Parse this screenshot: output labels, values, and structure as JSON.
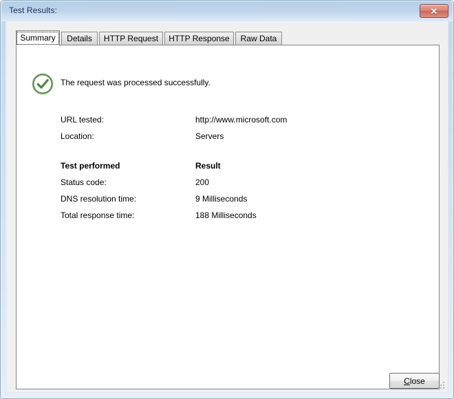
{
  "window": {
    "title": "Test Results:",
    "close_button_glyph": "✕",
    "close_button_name": "Close"
  },
  "tabs": [
    {
      "label": "Summary",
      "active": true
    },
    {
      "label": "Details",
      "active": false
    },
    {
      "label": "HTTP Request",
      "active": false
    },
    {
      "label": "HTTP Response",
      "active": false
    },
    {
      "label": "Raw Data",
      "active": false
    }
  ],
  "summary": {
    "status_icon": "success-check-icon",
    "status_message": "The request was processed successfully.",
    "info_rows": [
      {
        "label": "URL tested:",
        "value": "http://www.microsoft.com"
      },
      {
        "label": "Location:",
        "value": "Servers"
      }
    ],
    "results_header": {
      "label": "Test performed",
      "value": "Result"
    },
    "result_rows": [
      {
        "label": "Status code:",
        "value": "200"
      },
      {
        "label": "DNS resolution time:",
        "value": "9 Milliseconds"
      },
      {
        "label": "Total response time:",
        "value": "188 Milliseconds"
      }
    ]
  },
  "footer": {
    "close_accel": "C",
    "close_rest": "lose"
  },
  "colors": {
    "titlebar_top": "#b6cee6",
    "titlebar_bottom": "#dfeaf6",
    "close_button": "#d9816f",
    "success_green": "#4a8a3a",
    "dialog_bg": "#f0f0f0",
    "panel_bg": "#ffffff",
    "text": "#000000",
    "title_text": "#17365d"
  }
}
